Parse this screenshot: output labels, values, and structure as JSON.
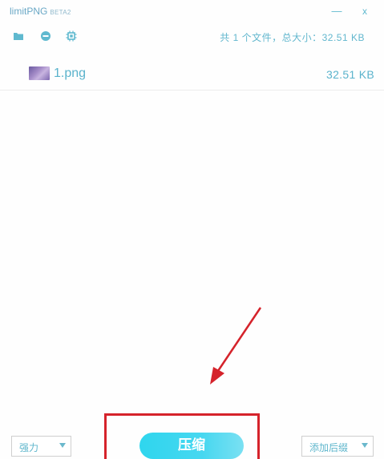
{
  "window": {
    "app_name": "limitPNG",
    "version": "BETA2",
    "minimize_glyph": "—",
    "close_glyph": "x"
  },
  "toolbar": {
    "icons": [
      "folder-icon",
      "minus-circle-icon",
      "chip-icon"
    ],
    "summary": "共 1 个文件，总大小：32.51 KB"
  },
  "files": [
    {
      "name": "1.png",
      "size": "32.51 KB"
    }
  ],
  "footer": {
    "strength_value": "强力",
    "compress_label": "压缩",
    "suffix_value": "添加后缀"
  },
  "colors": {
    "accent": "#5ab3cc",
    "button": "#2fd6ee",
    "annotation": "#d5232b"
  }
}
